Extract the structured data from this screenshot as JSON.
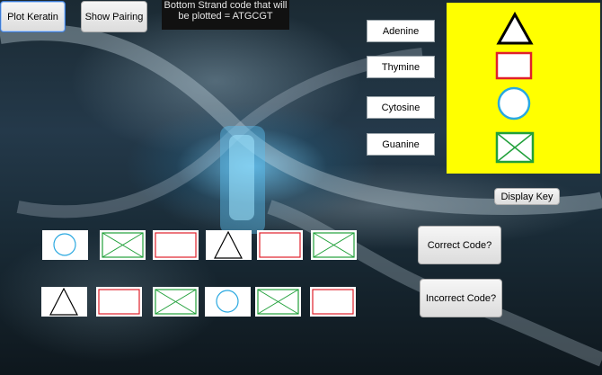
{
  "toolbar": {
    "plot_keratin_label": "Plot Keratin",
    "show_pairing_label": "Show Pairing"
  },
  "info": {
    "line1": "Bottom Strand code that will",
    "line2": "be plotted = ATGCGT"
  },
  "nucleotides": {
    "adenine": "Adenine",
    "thymine": "Thymine",
    "cytosine": "Cytosine",
    "guanine": "Guanine"
  },
  "key": {
    "background": "#ffff00",
    "symbols": [
      "triangle-icon",
      "rectangle-icon",
      "circle-icon",
      "crossed-box-icon"
    ]
  },
  "display_key_label": "Display Key",
  "top_strand": [
    "circle-icon",
    "crossed-box-icon",
    "rectangle-icon",
    "triangle-icon",
    "rectangle-icon",
    "crossed-box-icon"
  ],
  "bottom_strand": [
    "triangle-icon",
    "rectangle-icon",
    "crossed-box-icon",
    "circle-icon",
    "crossed-box-icon",
    "rectangle-icon"
  ],
  "answers": {
    "correct_label": "Correct Code?",
    "incorrect_label": "Incorrect Code?"
  },
  "colors": {
    "triangle": "#000000",
    "rectangle": "#e0202a",
    "circle": "#29a8e0",
    "crossed_box": "#21a03a"
  }
}
